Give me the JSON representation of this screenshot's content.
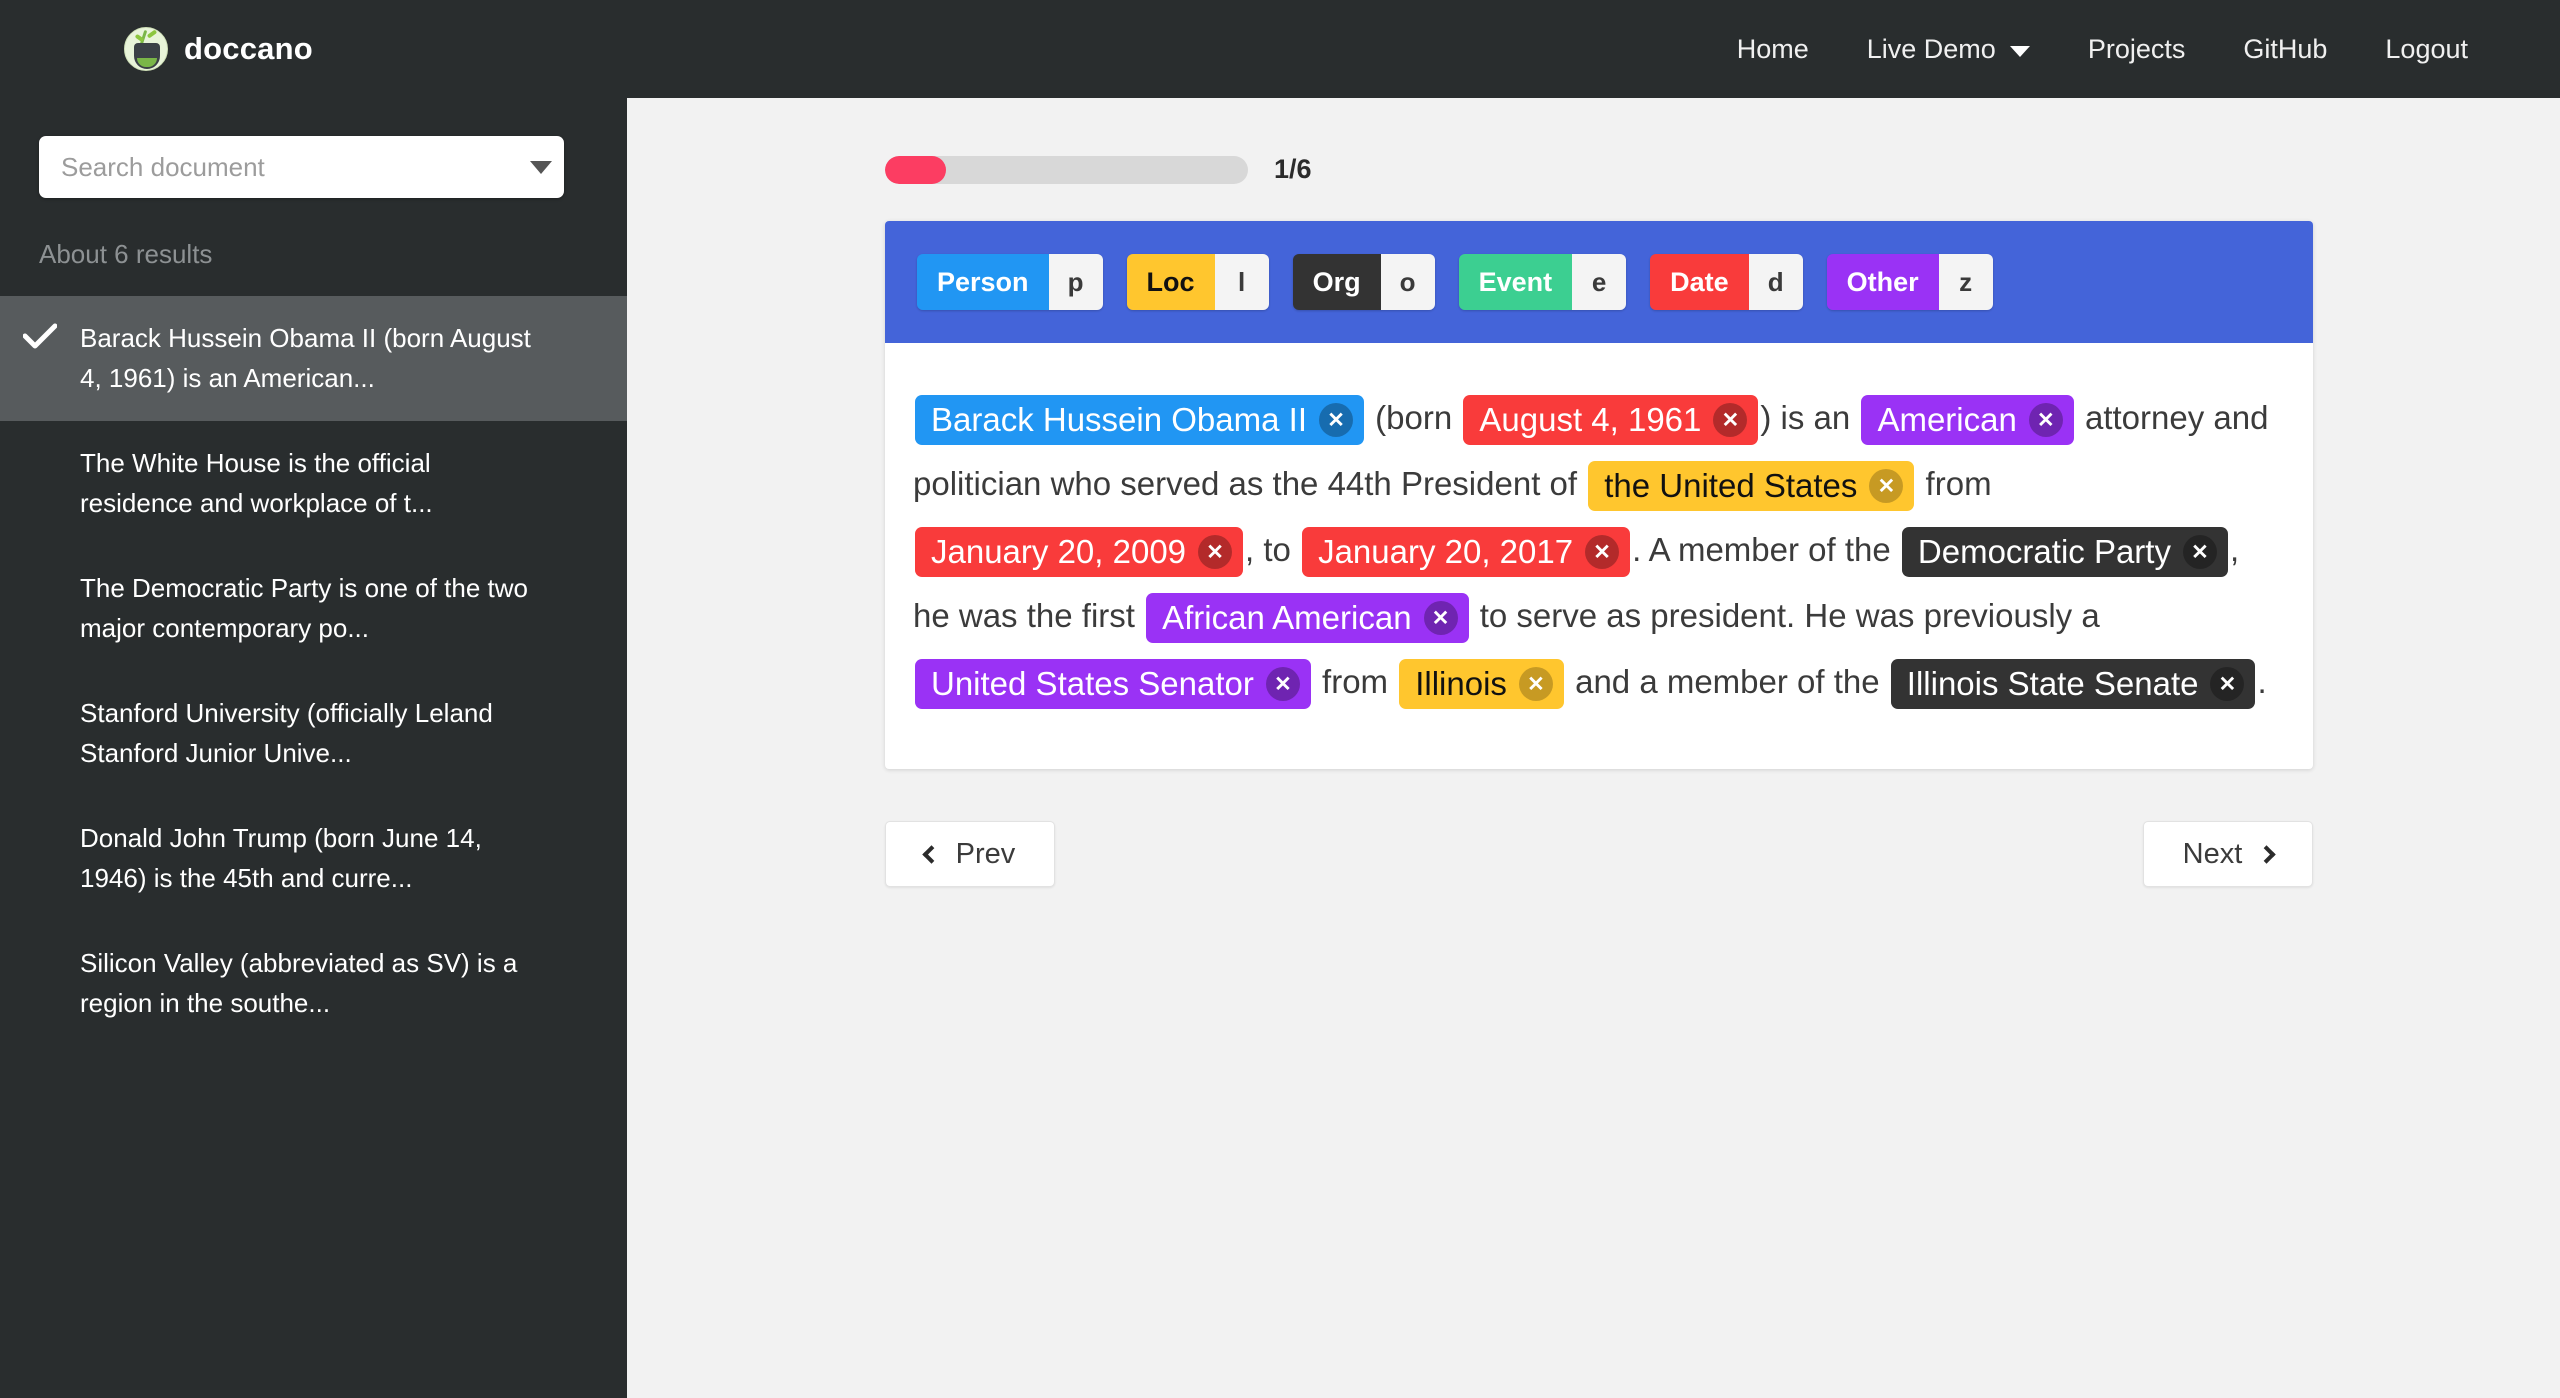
{
  "navbar": {
    "brand": "doccano",
    "brand_logo_icon": "doccano-panda-logo",
    "links": [
      {
        "label": "Home",
        "icon": null
      },
      {
        "label": "Live Demo",
        "icon": "chevron-down-icon"
      },
      {
        "label": "Projects",
        "icon": null
      },
      {
        "label": "GitHub",
        "icon": null
      },
      {
        "label": "Logout",
        "icon": null
      }
    ]
  },
  "sidebar": {
    "search": {
      "placeholder": "Search document",
      "value": "",
      "dropdown_icon": "chevron-down-icon"
    },
    "results_count": "About 6 results",
    "check_icon": "check-icon",
    "documents": [
      {
        "text": "Barack Hussein Obama II (born August 4, 1961) is an American...",
        "selected": true
      },
      {
        "text": "The White House is the official residence and workplace of t...",
        "selected": false
      },
      {
        "text": "The Democratic Party is one of the two major contemporary po...",
        "selected": false
      },
      {
        "text": "Stanford University (officially Leland Stanford Junior Unive...",
        "selected": false
      },
      {
        "text": "Donald John Trump (born June 14, 1946) is the 45th and curre...",
        "selected": false
      },
      {
        "text": "Silicon Valley (abbreviated as SV) is a region in the southe...",
        "selected": false
      }
    ]
  },
  "main": {
    "progress": {
      "current": 1,
      "total": 6,
      "label": "1/6",
      "percent": 16.7,
      "fill_color": "#fc3d62",
      "track_color": "#d8d8d8"
    },
    "label_bar": {
      "background": "#4464d9",
      "labels": [
        {
          "name": "Person",
          "shortcut": "p",
          "color": "#2196f3",
          "text_color": "#ffffff"
        },
        {
          "name": "Loc",
          "shortcut": "l",
          "color": "#ffc62e",
          "text_color": "#111111"
        },
        {
          "name": "Org",
          "shortcut": "o",
          "color": "#333333",
          "text_color": "#ffffff"
        },
        {
          "name": "Event",
          "shortcut": "e",
          "color": "#3ccf91",
          "text_color": "#ffffff"
        },
        {
          "name": "Date",
          "shortcut": "d",
          "color": "#f93b3b",
          "text_color": "#ffffff"
        },
        {
          "name": "Other",
          "shortcut": "z",
          "color": "#9a32f5",
          "text_color": "#ffffff"
        }
      ]
    },
    "document": {
      "delete_icon": "close-icon",
      "tokens": [
        {
          "type": "entity",
          "text": "Barack Hussein Obama II",
          "label": "Person",
          "color": "#2196f3",
          "text_color": "#ffffff"
        },
        {
          "type": "text",
          "text": " (born "
        },
        {
          "type": "entity",
          "text": "August 4, 1961",
          "label": "Date",
          "color": "#f93b3b",
          "text_color": "#ffffff"
        },
        {
          "type": "text",
          "text": ") is an "
        },
        {
          "type": "entity",
          "text": "American",
          "label": "Other",
          "color": "#9a32f5",
          "text_color": "#ffffff"
        },
        {
          "type": "text",
          "text": " attorney and politician who served as the 44th President of "
        },
        {
          "type": "entity",
          "text": "the United States",
          "label": "Loc",
          "color": "#ffc62e",
          "text_color": "#111111"
        },
        {
          "type": "text",
          "text": " from "
        },
        {
          "type": "entity",
          "text": "January 20, 2009",
          "label": "Date",
          "color": "#f93b3b",
          "text_color": "#ffffff"
        },
        {
          "type": "text",
          "text": ", to "
        },
        {
          "type": "entity",
          "text": "January 20, 2017",
          "label": "Date",
          "color": "#f93b3b",
          "text_color": "#ffffff"
        },
        {
          "type": "text",
          "text": ". A member of the "
        },
        {
          "type": "entity",
          "text": "Democratic Party",
          "label": "Org",
          "color": "#333333",
          "text_color": "#ffffff"
        },
        {
          "type": "text",
          "text": ", he was the first "
        },
        {
          "type": "entity",
          "text": "African American",
          "label": "Other",
          "color": "#9a32f5",
          "text_color": "#ffffff"
        },
        {
          "type": "text",
          "text": " to serve as president. He was previously a "
        },
        {
          "type": "entity",
          "text": "United States Senator",
          "label": "Other",
          "color": "#9a32f5",
          "text_color": "#ffffff"
        },
        {
          "type": "text",
          "text": " from "
        },
        {
          "type": "entity",
          "text": "Illinois",
          "label": "Loc",
          "color": "#ffc62e",
          "text_color": "#111111"
        },
        {
          "type": "text",
          "text": " and a member of the "
        },
        {
          "type": "entity",
          "text": "Illinois State Senate",
          "label": "Org",
          "color": "#333333",
          "text_color": "#ffffff"
        },
        {
          "type": "text",
          "text": "."
        }
      ]
    },
    "pager": {
      "prev_label": "Prev",
      "next_label": "Next",
      "prev_icon": "chevron-left-icon",
      "next_icon": "chevron-right-icon"
    }
  }
}
